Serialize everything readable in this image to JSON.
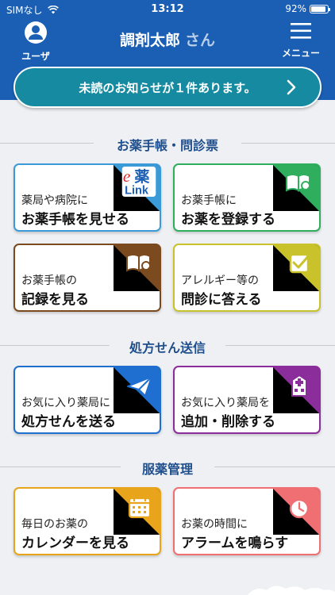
{
  "status": {
    "carrier": "SIMなし",
    "time": "13:12",
    "battery": "92%",
    "battery_level": 0.92
  },
  "header": {
    "user_label": "ユーザ",
    "user_name": "調剤太郎",
    "honorific": "さん",
    "menu_label": "メニュー"
  },
  "notice": {
    "text": "未読のお知らせが１件あります。"
  },
  "sections": [
    {
      "title": "お薬手帳・問診票",
      "cards": [
        {
          "line1": "薬局や病院に",
          "line2": "お薬手帳を見せる",
          "icon": "e-kusuri-link-logo",
          "logo_e": "e",
          "logo_kanji": "薬",
          "logo_link": "Link",
          "color": "#3b9bd9"
        },
        {
          "line1": "お薬手帳に",
          "line2": "お薬を登録する",
          "icon": "book-search-icon",
          "color": "#2fae5e"
        },
        {
          "line1": "お薬手帳の",
          "line2": "記録を見る",
          "icon": "book-magnifier-icon",
          "color": "#7b4a1e"
        },
        {
          "line1": "アレルギー等の",
          "line2": "問診に答える",
          "icon": "checkbox-icon",
          "color": "#c9c22a"
        }
      ]
    },
    {
      "title": "処方せん送信",
      "cards": [
        {
          "line1": "お気に入り薬局に",
          "line2": "処方せんを送る",
          "icon": "paper-plane-icon",
          "color": "#1f6fd1"
        },
        {
          "line1": "お気に入り薬局を",
          "line2": "追加・削除する",
          "icon": "hospital-building-icon",
          "color": "#8b2d9a"
        }
      ]
    },
    {
      "title": "服薬管理",
      "cards": [
        {
          "line1": "毎日のお薬の",
          "line2": "カレンダーを見る",
          "icon": "calendar-icon",
          "color": "#e8a51b"
        },
        {
          "line1": "お薬の時間に",
          "line2": "アラームを鳴らす",
          "icon": "alarm-clock-icon",
          "color": "#ef6f73"
        }
      ]
    }
  ]
}
